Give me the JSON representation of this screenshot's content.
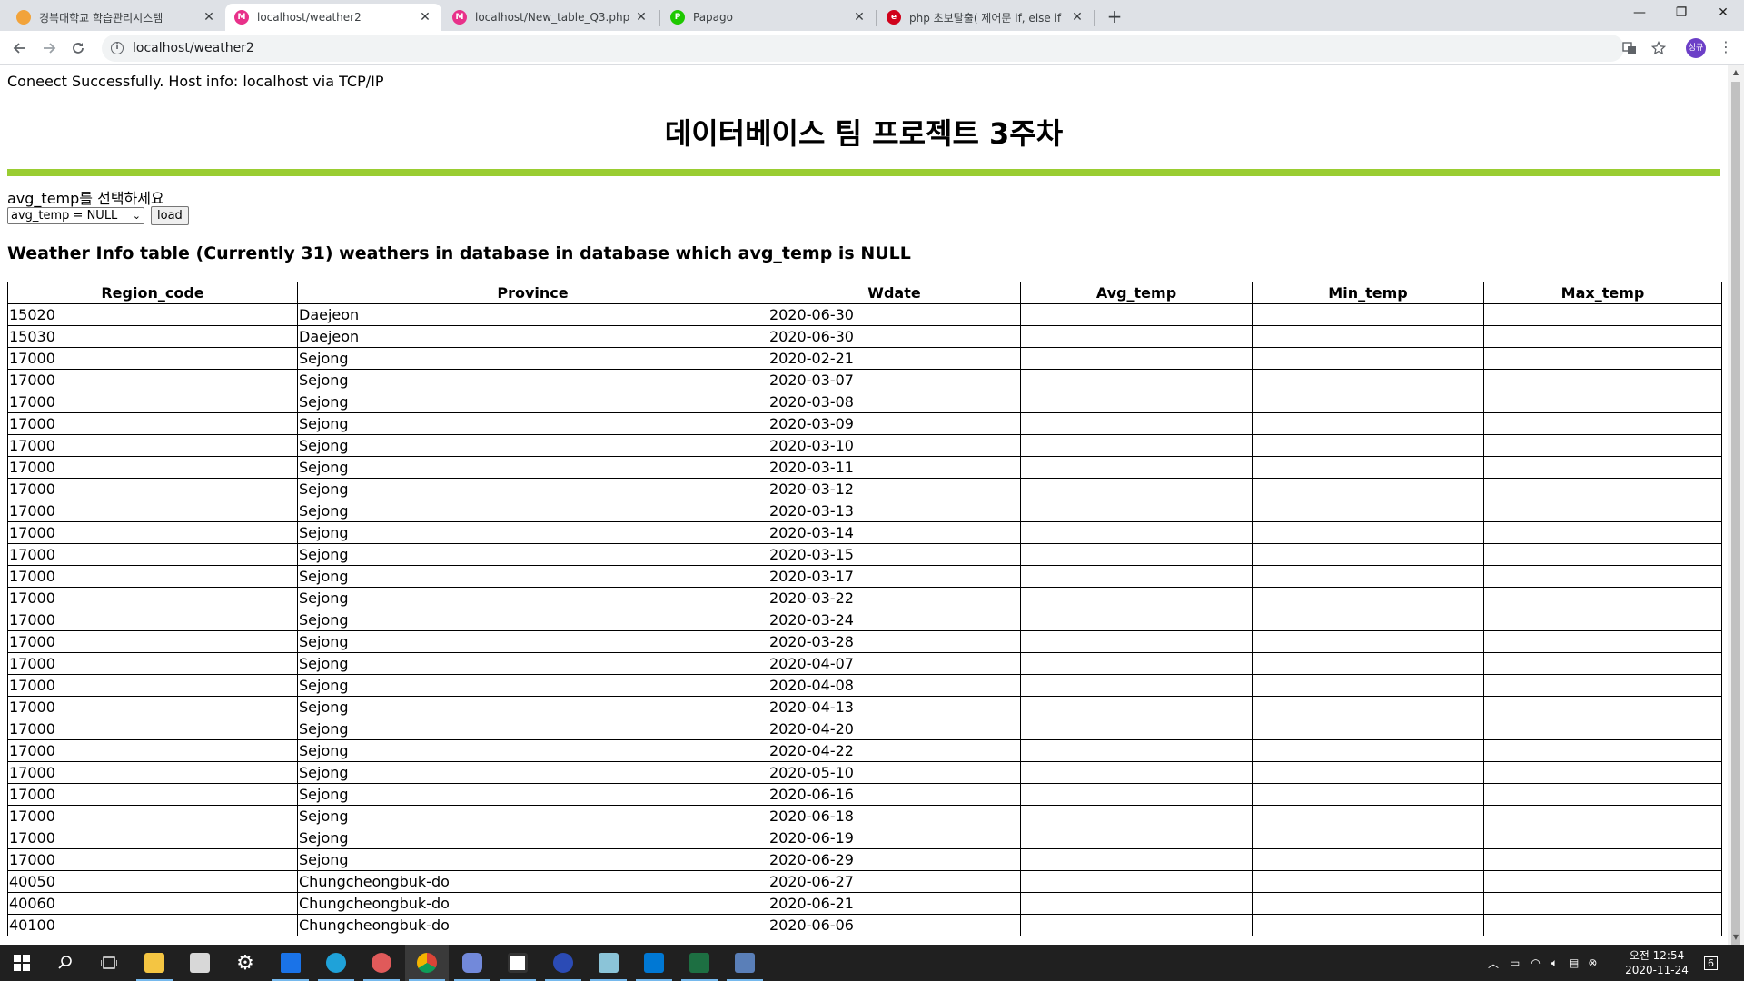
{
  "browser": {
    "tabs": [
      {
        "title": "경북대학교 학습관리시스템",
        "favicon_color": "#f2a33a"
      },
      {
        "title": "localhost/weather2",
        "favicon_color": "#e8318a"
      },
      {
        "title": "localhost/New_table_Q3.php",
        "favicon_color": "#e8318a"
      },
      {
        "title": "Papago",
        "favicon_color": "#1ec800"
      },
      {
        "title": "php 초보탈출( 제어문 if, else if",
        "favicon_color": "#d0021b"
      }
    ],
    "new_tab": "+",
    "address": "localhost/weather2",
    "profile_initials": "성규",
    "window_controls": {
      "minimize": "—",
      "restore": "❐",
      "close": "✕"
    }
  },
  "page": {
    "connect_message": "Coneect Successfully. Host info: localhost via TCP/IP",
    "title": "데이터베이스 팀 프로젝트 3주차",
    "select_label": "avg_temp를 선택하세요",
    "select_value": "avg_temp = NULL",
    "load_button": "load",
    "table_heading": "Weather Info table (Currently 31) weathers in database in database which avg_temp is NULL",
    "columns": [
      "Region_code",
      "Province",
      "Wdate",
      "Avg_temp",
      "Min_temp",
      "Max_temp"
    ],
    "rows": [
      [
        "15020",
        "Daejeon",
        "2020-06-30",
        "",
        "",
        ""
      ],
      [
        "15030",
        "Daejeon",
        "2020-06-30",
        "",
        "",
        ""
      ],
      [
        "17000",
        "Sejong",
        "2020-02-21",
        "",
        "",
        ""
      ],
      [
        "17000",
        "Sejong",
        "2020-03-07",
        "",
        "",
        ""
      ],
      [
        "17000",
        "Sejong",
        "2020-03-08",
        "",
        "",
        ""
      ],
      [
        "17000",
        "Sejong",
        "2020-03-09",
        "",
        "",
        ""
      ],
      [
        "17000",
        "Sejong",
        "2020-03-10",
        "",
        "",
        ""
      ],
      [
        "17000",
        "Sejong",
        "2020-03-11",
        "",
        "",
        ""
      ],
      [
        "17000",
        "Sejong",
        "2020-03-12",
        "",
        "",
        ""
      ],
      [
        "17000",
        "Sejong",
        "2020-03-13",
        "",
        "",
        ""
      ],
      [
        "17000",
        "Sejong",
        "2020-03-14",
        "",
        "",
        ""
      ],
      [
        "17000",
        "Sejong",
        "2020-03-15",
        "",
        "",
        ""
      ],
      [
        "17000",
        "Sejong",
        "2020-03-17",
        "",
        "",
        ""
      ],
      [
        "17000",
        "Sejong",
        "2020-03-22",
        "",
        "",
        ""
      ],
      [
        "17000",
        "Sejong",
        "2020-03-24",
        "",
        "",
        ""
      ],
      [
        "17000",
        "Sejong",
        "2020-03-28",
        "",
        "",
        ""
      ],
      [
        "17000",
        "Sejong",
        "2020-04-07",
        "",
        "",
        ""
      ],
      [
        "17000",
        "Sejong",
        "2020-04-08",
        "",
        "",
        ""
      ],
      [
        "17000",
        "Sejong",
        "2020-04-13",
        "",
        "",
        ""
      ],
      [
        "17000",
        "Sejong",
        "2020-04-20",
        "",
        "",
        ""
      ],
      [
        "17000",
        "Sejong",
        "2020-04-22",
        "",
        "",
        ""
      ],
      [
        "17000",
        "Sejong",
        "2020-05-10",
        "",
        "",
        ""
      ],
      [
        "17000",
        "Sejong",
        "2020-06-16",
        "",
        "",
        ""
      ],
      [
        "17000",
        "Sejong",
        "2020-06-18",
        "",
        "",
        ""
      ],
      [
        "17000",
        "Sejong",
        "2020-06-19",
        "",
        "",
        ""
      ],
      [
        "17000",
        "Sejong",
        "2020-06-29",
        "",
        "",
        ""
      ],
      [
        "40050",
        "Chungcheongbuk-do",
        "2020-06-27",
        "",
        "",
        ""
      ],
      [
        "40060",
        "Chungcheongbuk-do",
        "2020-06-21",
        "",
        "",
        ""
      ],
      [
        "40100",
        "Chungcheongbuk-do",
        "2020-06-06",
        "",
        "",
        ""
      ]
    ],
    "accent_color": "#9acd32"
  },
  "taskbar": {
    "apps": [
      "windows-start-icon",
      "search-icon",
      "task-view-icon",
      "file-explorer-icon",
      "store-icon",
      "settings-icon",
      "mail-icon",
      "edge-icon",
      "app-icon",
      "chrome-icon",
      "discord-icon",
      "app-window-icon",
      "vpn-icon",
      "notepad-icon",
      "vscode-icon",
      "excel-icon",
      "calculator-icon"
    ],
    "time": "오전 12:54",
    "date": "2020-11-24",
    "notification_count": "6"
  }
}
